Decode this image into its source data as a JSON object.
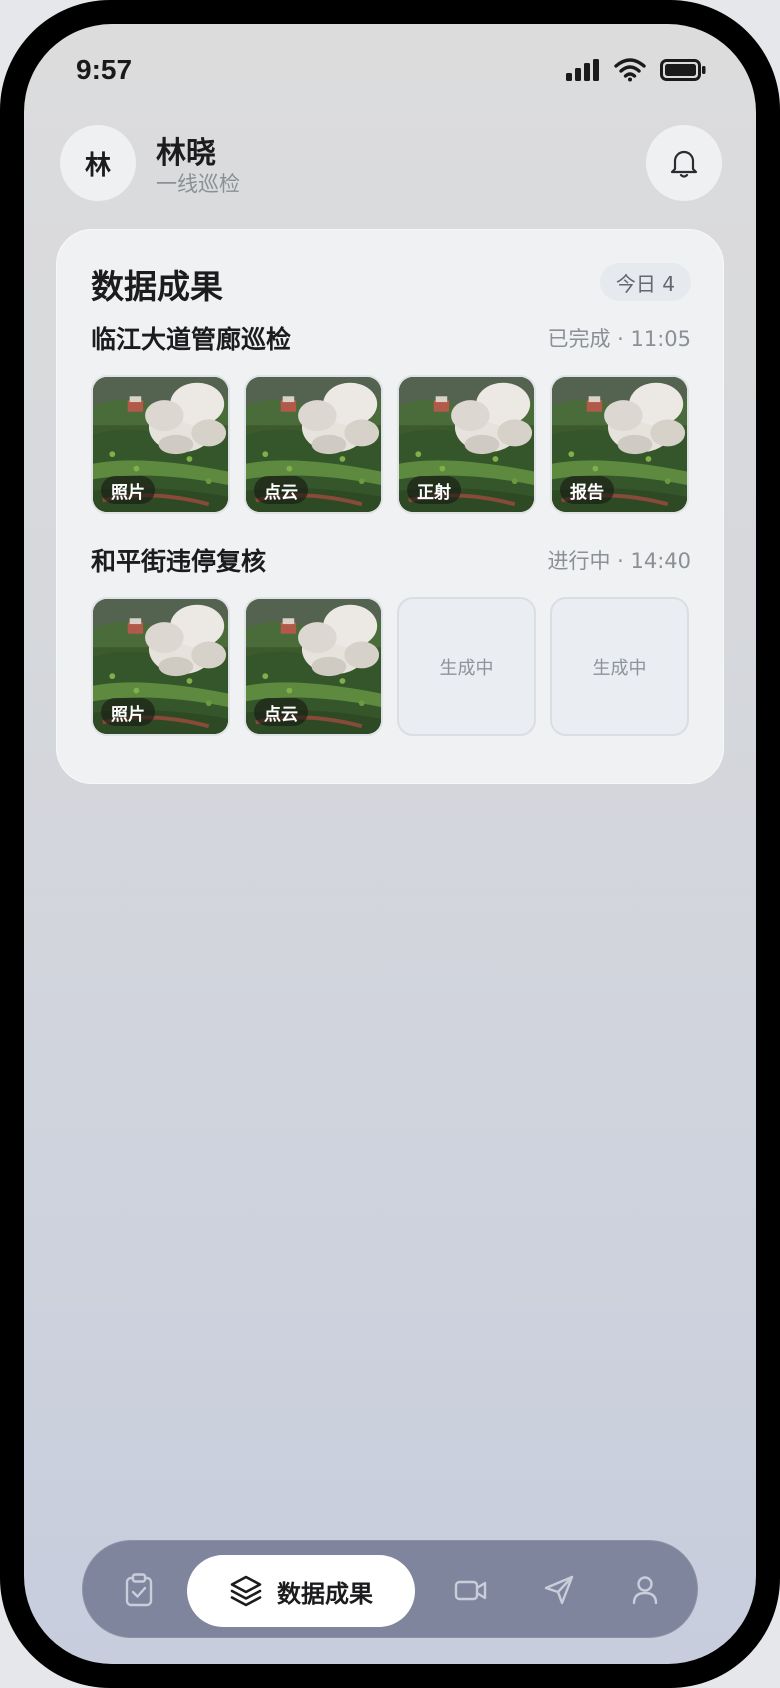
{
  "status_bar": {
    "time": "9:57"
  },
  "header": {
    "avatar_text": "林",
    "user_name": "林晓",
    "user_role": "一线巡检",
    "bell_icon": "bell-icon"
  },
  "card": {
    "title": "数据成果",
    "badge": "今日 4",
    "tasks": [
      {
        "title": "临江大道管廊巡检",
        "meta": "已完成 · 11:05",
        "tiles": [
          {
            "label": "照片",
            "state": "ready"
          },
          {
            "label": "点云",
            "state": "ready"
          },
          {
            "label": "正射",
            "state": "ready"
          },
          {
            "label": "报告",
            "state": "ready"
          }
        ]
      },
      {
        "title": "和平街违停复核",
        "meta": "进行中 · 14:40",
        "tiles": [
          {
            "label": "照片",
            "state": "ready"
          },
          {
            "label": "点云",
            "state": "ready"
          },
          {
            "label": "生成中",
            "state": "pending"
          },
          {
            "label": "生成中",
            "state": "pending"
          }
        ]
      }
    ]
  },
  "nav": {
    "items": [
      {
        "icon": "clipboard-check-icon"
      },
      {
        "icon": "layers-icon",
        "label": "数据成果",
        "active": true
      },
      {
        "icon": "video-camera-icon"
      },
      {
        "icon": "send-icon"
      },
      {
        "icon": "user-icon"
      }
    ]
  },
  "colors": {
    "nav_bg": "#7e859c",
    "card_bg": "#eff1f3",
    "accent": "#ffffff"
  }
}
